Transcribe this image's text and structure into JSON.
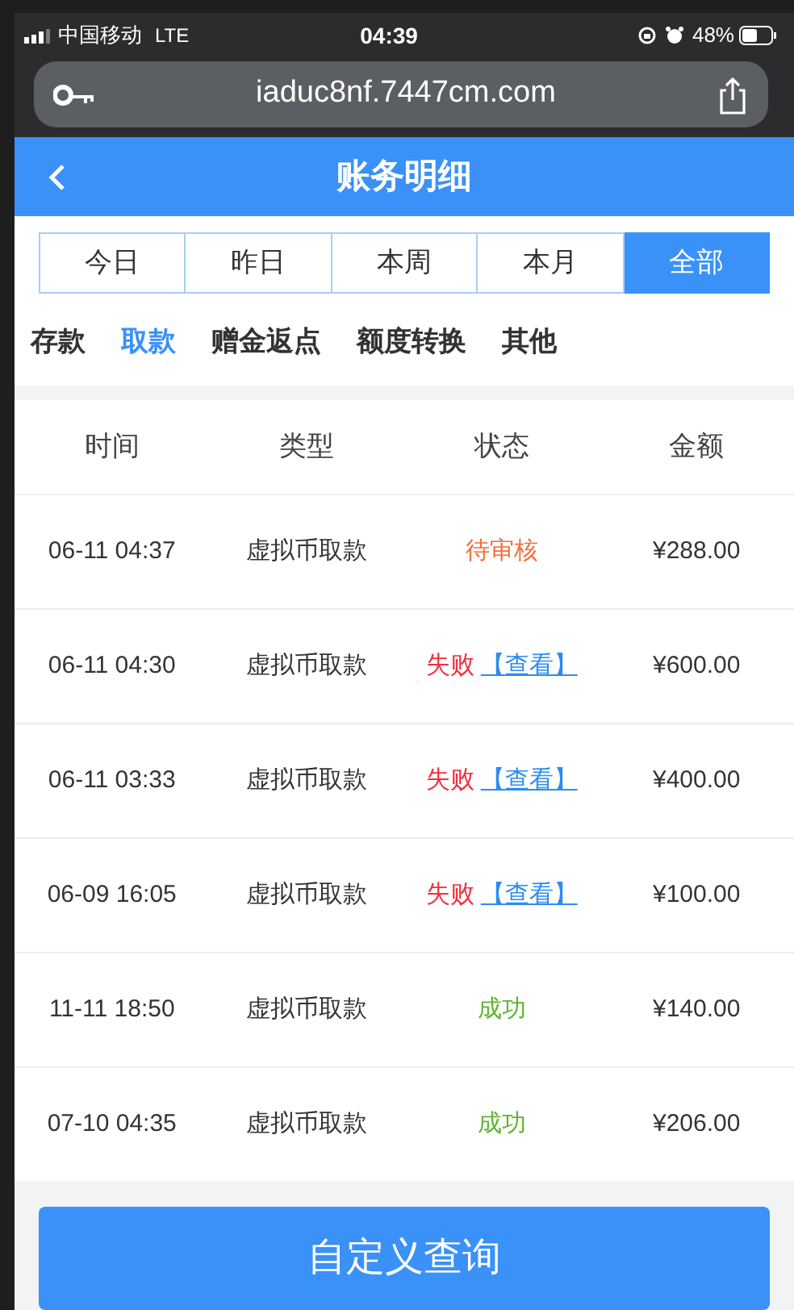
{
  "status_bar": {
    "carrier": "中国移动",
    "network": "LTE",
    "time": "04:39",
    "battery": "48%"
  },
  "browser": {
    "url": "iaduc8nf.7447cm.com"
  },
  "header": {
    "title": "账务明细"
  },
  "periods": [
    {
      "label": "今日",
      "selected": false
    },
    {
      "label": "昨日",
      "selected": false
    },
    {
      "label": "本周",
      "selected": false
    },
    {
      "label": "本月",
      "selected": false
    },
    {
      "label": "全部",
      "selected": true
    }
  ],
  "categories": [
    {
      "label": "存款",
      "selected": false
    },
    {
      "label": "取款",
      "selected": true
    },
    {
      "label": "赠金返点",
      "selected": false
    },
    {
      "label": "额度转换",
      "selected": false
    },
    {
      "label": "其他",
      "selected": false
    }
  ],
  "table": {
    "columns": [
      "时间",
      "类型",
      "状态",
      "金额"
    ],
    "rows": [
      {
        "time": "06-11 04:37",
        "type": "虚拟币取款",
        "status": "待审核",
        "color": "#f56c3a",
        "amount": "¥288.00"
      },
      {
        "time": "06-11 04:30",
        "type": "虚拟币取款",
        "status": "失败",
        "color": "#f0303c",
        "link": "【查看】",
        "amount": "¥600.00"
      },
      {
        "time": "06-11 03:33",
        "type": "虚拟币取款",
        "status": "失败",
        "color": "#f0303c",
        "link": "【查看】",
        "amount": "¥400.00"
      },
      {
        "time": "06-09 16:05",
        "type": "虚拟币取款",
        "status": "失败",
        "color": "#f0303c",
        "link": "【查看】",
        "amount": "¥100.00"
      },
      {
        "time": "11-11 18:50",
        "type": "虚拟币取款",
        "status": "成功",
        "color": "#5cb531",
        "amount": "¥140.00"
      },
      {
        "time": "07-10 04:35",
        "type": "虚拟币取款",
        "status": "成功",
        "color": "#5cb531",
        "amount": "¥206.00"
      }
    ]
  },
  "query_button": "自定义查询"
}
